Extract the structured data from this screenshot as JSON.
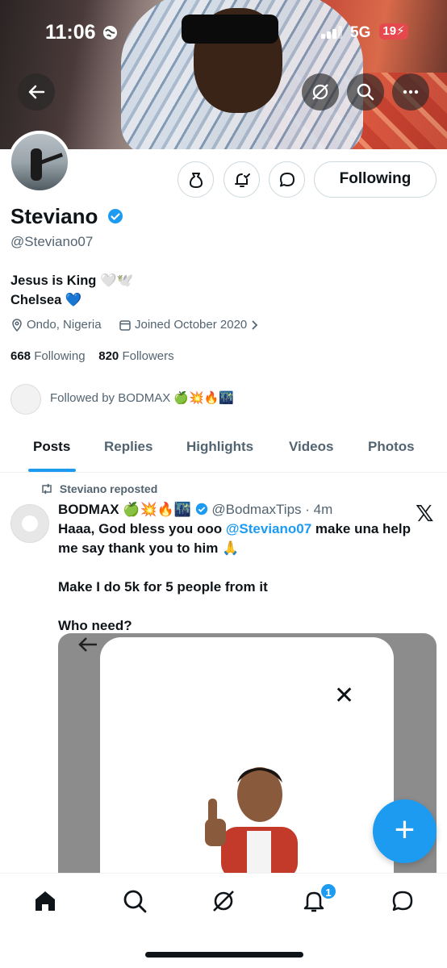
{
  "status_bar": {
    "time": "11:06",
    "network": "5G",
    "battery": "19"
  },
  "profile": {
    "name": "Steviano",
    "handle": "@Steviano07",
    "bio_line1": "Jesus is King 🤍🕊️",
    "bio_line2": "Chelsea 💙",
    "location": "Ondo, Nigeria",
    "joined": "Joined October 2020",
    "following_count": "668",
    "following_label": "Following",
    "followers_count": "820",
    "followers_label": "Followers",
    "followed_by": "Followed by BODMAX 🍏💥🔥🌃",
    "follow_button": "Following"
  },
  "tabs": [
    "Posts",
    "Replies",
    "Highlights",
    "Videos",
    "Photos"
  ],
  "active_tab": "Posts",
  "tweet": {
    "repost_label": "Steviano reposted",
    "author_name": "BODMAX 🍏💥🔥🌃",
    "author_handle": "@BodmaxTips",
    "time": "· 4m",
    "text_part1": "Haaa, God bless you ooo ",
    "mention": "@Steviano07",
    "text_part2": " make una help me say thank you to him 🙏",
    "line2": "Make I do 5k for 5 people from it",
    "line3": "Who need?"
  },
  "compose_fab": "+",
  "nav": {
    "notifications_badge": "1"
  },
  "colors": {
    "accent": "#1d9bf0",
    "text": "#0f1419",
    "muted": "#536471",
    "border": "#cfd9de"
  },
  "icons": [
    "back-icon",
    "grok-icon",
    "search-icon",
    "more-icon",
    "subscribe-icon",
    "notify-icon",
    "message-icon",
    "verified-icon",
    "location-icon",
    "calendar-icon",
    "chevron-right-icon",
    "repost-icon",
    "x-logo-icon",
    "close-icon",
    "home-icon",
    "grok-nav-icon",
    "bell-icon",
    "messages-icon"
  ]
}
